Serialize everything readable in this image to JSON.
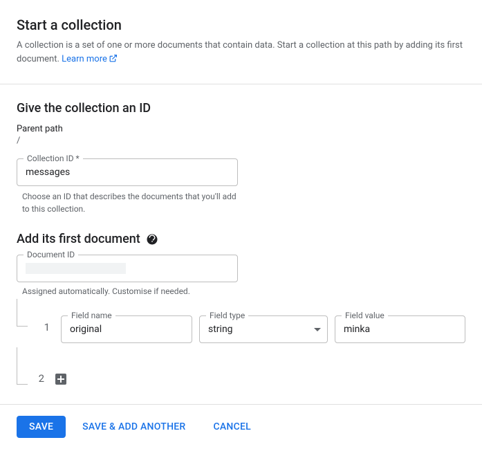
{
  "header": {
    "title": "Start a collection",
    "description": "A collection is a set of one or more documents that contain data. Start a collection at this path by adding its first document. ",
    "learn_more": "Learn more"
  },
  "collection": {
    "section_title": "Give the collection an ID",
    "parent_path_label": "Parent path",
    "parent_path_value": "/",
    "id_label": "Collection ID *",
    "id_value": "messages",
    "id_helper": "Choose an ID that describes the documents that you'll add to this collection."
  },
  "document": {
    "section_title": "Add its first document",
    "id_label": "Document ID",
    "id_value": "",
    "id_helper": "Assigned automatically. Customise if needed.",
    "rows": [
      {
        "index": "1",
        "name_label": "Field name",
        "name_value": "original",
        "type_label": "Field type",
        "type_value": "string",
        "value_label": "Field value",
        "value_value": "minka"
      }
    ],
    "next_index": "2"
  },
  "footer": {
    "save": "SAVE",
    "save_another": "SAVE & ADD ANOTHER",
    "cancel": "CANCEL"
  }
}
